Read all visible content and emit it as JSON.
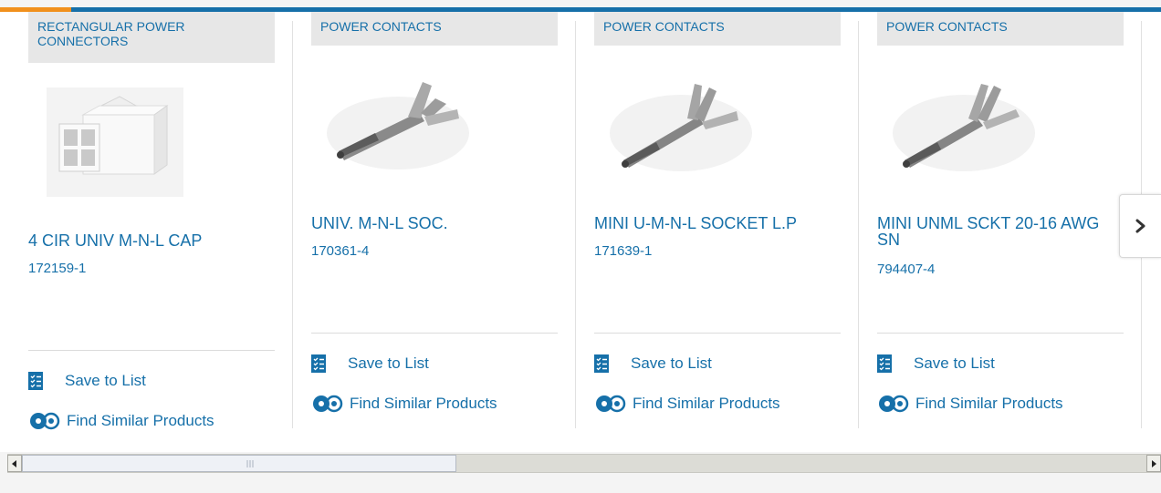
{
  "products": [
    {
      "category": "RECTANGULAR POWER CONNECTORS",
      "title": "4 CIR UNIV M-N-L CAP",
      "part_number": "172159-1"
    },
    {
      "category": "POWER CONTACTS",
      "title": "UNIV. M-N-L SOC.",
      "part_number": "170361-4"
    },
    {
      "category": "POWER CONTACTS",
      "title": "MINI U-M-N-L SOCKET L.P",
      "part_number": "171639-1"
    },
    {
      "category": "POWER CONTACTS",
      "title": "MINI UNML SCKT 20-16 AWG SN",
      "part_number": "794407-4"
    }
  ],
  "actions": {
    "save_label": "Save to List",
    "similar_label": "Find Similar Products"
  },
  "carousel": {
    "next_icon": "chevron-right-icon"
  },
  "colors": {
    "brand_blue": "#1670a9",
    "accent_orange": "#f1901c",
    "category_bg": "#e7e7e7"
  }
}
